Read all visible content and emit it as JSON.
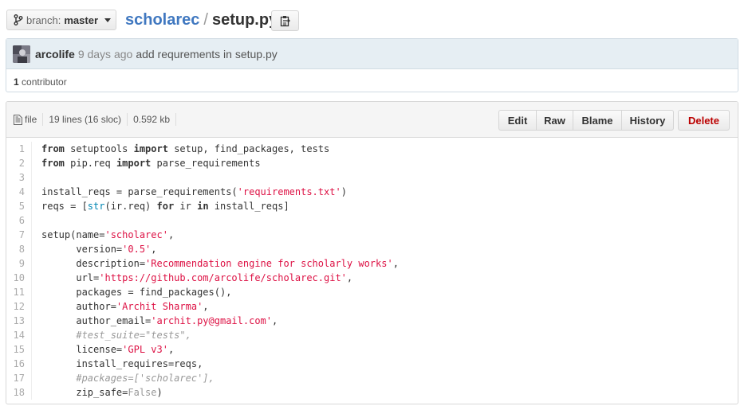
{
  "branch": {
    "label": "branch:",
    "name": "master"
  },
  "breadcrumb": {
    "repo": "scholarec",
    "separator": "/",
    "file": "setup.py"
  },
  "commit": {
    "author": "arcolife",
    "time": "9 days ago",
    "message": "add requrements in setup.py",
    "contributors_count": "1",
    "contributors_label": "contributor"
  },
  "file_info": {
    "type": "file",
    "lines": "19 lines (16 sloc)",
    "size": "0.592 kb"
  },
  "actions": {
    "edit": "Edit",
    "raw": "Raw",
    "blame": "Blame",
    "history": "History",
    "delete": "Delete"
  },
  "code": {
    "line_numbers": [
      "1",
      "2",
      "3",
      "4",
      "5",
      "6",
      "7",
      "8",
      "9",
      "10",
      "11",
      "12",
      "13",
      "14",
      "15",
      "16",
      "17",
      "18"
    ],
    "lines": [
      [
        {
          "t": "kw",
          "v": "from"
        },
        {
          "t": "",
          "v": " setuptools "
        },
        {
          "t": "kw",
          "v": "import"
        },
        {
          "t": "",
          "v": " setup, find_packages, tests"
        }
      ],
      [
        {
          "t": "kw",
          "v": "from"
        },
        {
          "t": "",
          "v": " pip.req "
        },
        {
          "t": "kw",
          "v": "import"
        },
        {
          "t": "",
          "v": " parse_requirements"
        }
      ],
      [],
      [
        {
          "t": "",
          "v": "install_reqs = parse_requirements("
        },
        {
          "t": "str",
          "v": "'requirements.txt'"
        },
        {
          "t": "",
          "v": ")"
        }
      ],
      [
        {
          "t": "",
          "v": "reqs = ["
        },
        {
          "t": "bi",
          "v": "str"
        },
        {
          "t": "",
          "v": "(ir.req) "
        },
        {
          "t": "kw",
          "v": "for"
        },
        {
          "t": "",
          "v": " ir "
        },
        {
          "t": "kw",
          "v": "in"
        },
        {
          "t": "",
          "v": " install_reqs]"
        }
      ],
      [],
      [
        {
          "t": "",
          "v": "setup(name="
        },
        {
          "t": "str",
          "v": "'scholarec'"
        },
        {
          "t": "",
          "v": ","
        }
      ],
      [
        {
          "t": "",
          "v": "      version="
        },
        {
          "t": "str",
          "v": "'0.5'"
        },
        {
          "t": "",
          "v": ","
        }
      ],
      [
        {
          "t": "",
          "v": "      description="
        },
        {
          "t": "str",
          "v": "'Recommendation engine for scholarly works'"
        },
        {
          "t": "",
          "v": ","
        }
      ],
      [
        {
          "t": "",
          "v": "      url="
        },
        {
          "t": "str",
          "v": "'https://github.com/arcolife/scholarec.git'"
        },
        {
          "t": "",
          "v": ","
        }
      ],
      [
        {
          "t": "",
          "v": "      packages = find_packages(),"
        }
      ],
      [
        {
          "t": "",
          "v": "      author="
        },
        {
          "t": "str",
          "v": "'Archit Sharma'"
        },
        {
          "t": "",
          "v": ","
        }
      ],
      [
        {
          "t": "",
          "v": "      author_email="
        },
        {
          "t": "str",
          "v": "'archit.py@gmail.com'"
        },
        {
          "t": "",
          "v": ","
        }
      ],
      [
        {
          "t": "",
          "v": "      "
        },
        {
          "t": "cm",
          "v": "#test_suite=\"tests\","
        }
      ],
      [
        {
          "t": "",
          "v": "      license="
        },
        {
          "t": "str",
          "v": "'GPL v3'"
        },
        {
          "t": "",
          "v": ","
        }
      ],
      [
        {
          "t": "",
          "v": "      install_requires=reqs,"
        }
      ],
      [
        {
          "t": "",
          "v": "      "
        },
        {
          "t": "cm",
          "v": "#packages=['scholarec'],"
        }
      ],
      [
        {
          "t": "",
          "v": "      zip_safe="
        },
        {
          "t": "cst",
          "v": "False"
        },
        {
          "t": "",
          "v": ")"
        }
      ]
    ]
  }
}
